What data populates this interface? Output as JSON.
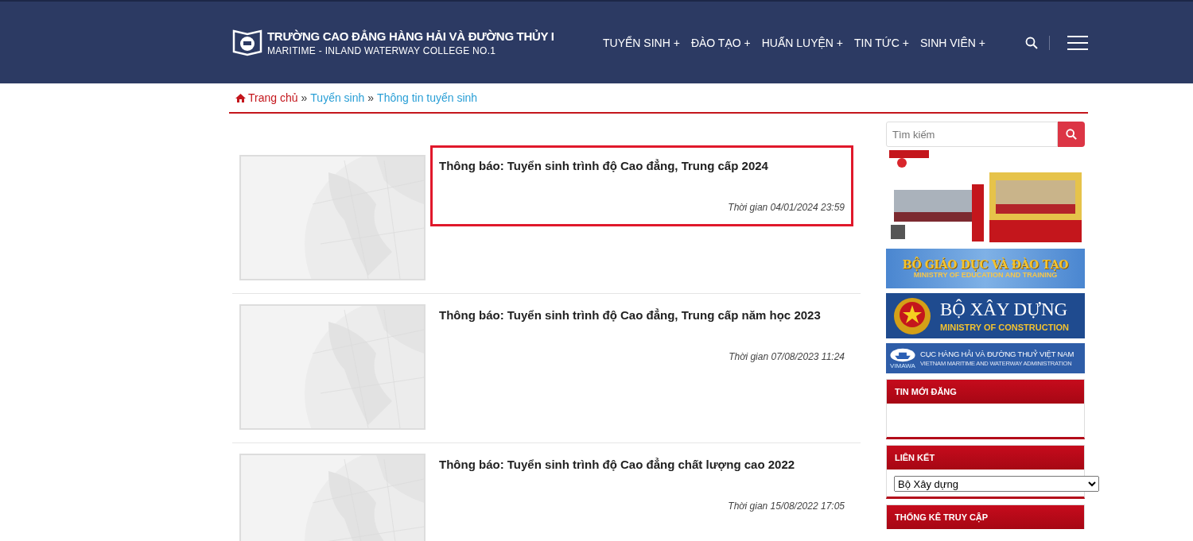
{
  "header": {
    "title": "TRƯỜNG CAO ĐẲNG HÀNG HẢI VÀ ĐƯỜNG THỦY I",
    "subtitle": "MARITIME - INLAND WATERWAY COLLEGE NO.1",
    "nav": [
      {
        "label": "TUYỂN SINH +"
      },
      {
        "label": "ĐÀO TẠO +"
      },
      {
        "label": "HUẤN LUYỆN +"
      },
      {
        "label": "TIN TỨC +"
      },
      {
        "label": "SINH VIÊN +"
      }
    ]
  },
  "breadcrumb": [
    {
      "label": "Trang chủ",
      "kind": "home"
    },
    {
      "label": "»",
      "kind": "sep"
    },
    {
      "label": "Tuyển sinh",
      "kind": "link"
    },
    {
      "label": "»",
      "kind": "sep"
    },
    {
      "label": "Thông tin tuyển sinh",
      "kind": "link"
    }
  ],
  "articles": [
    {
      "title": "Thông báo: Tuyển sinh trình độ Cao đẳng, Trung cấp 2024",
      "time": "Thời gian 04/01/2024 23:59",
      "selected": true
    },
    {
      "title": "Thông báo: Tuyển sinh trình độ Cao đẳng, Trung cấp năm học 2023",
      "time": "Thời gian 07/08/2023 11:24",
      "selected": false
    },
    {
      "title": "Thông báo: Tuyển sinh trình độ Cao đẳng chất lượng cao 2022",
      "time": "Thời gian 15/08/2022 17:05",
      "selected": false
    }
  ],
  "sidebar": {
    "search": {
      "placeholder": "Tìm kiếm"
    },
    "banners": [
      {
        "kind": "moet",
        "title": "BỘ GIÁO DỤC VÀ ĐÀO TẠO",
        "subtitle": "MINISTRY OF EDUCATION AND TRAINING"
      },
      {
        "kind": "moc",
        "title": "BỘ XÂY DỰNG",
        "subtitle": "MINISTRY OF CONSTRUCTION"
      },
      {
        "kind": "vimawa",
        "title": "CỤC HÀNG HẢI VÀ ĐƯỜNG THUỶ VIỆT NAM",
        "subtitle": "VIETNAM MARITIME AND WATERWAY ADMINISTRATION",
        "badge": "VIMAWA"
      }
    ],
    "widgets": [
      {
        "kind": "empty",
        "title": "TIN MỚI ĐĂNG"
      },
      {
        "kind": "select",
        "title": "LIÊN KẾT",
        "value": "Bộ Xây dựng"
      },
      {
        "kind": "cut",
        "title": "THỐNG KÊ TRUY CẬP"
      }
    ]
  }
}
